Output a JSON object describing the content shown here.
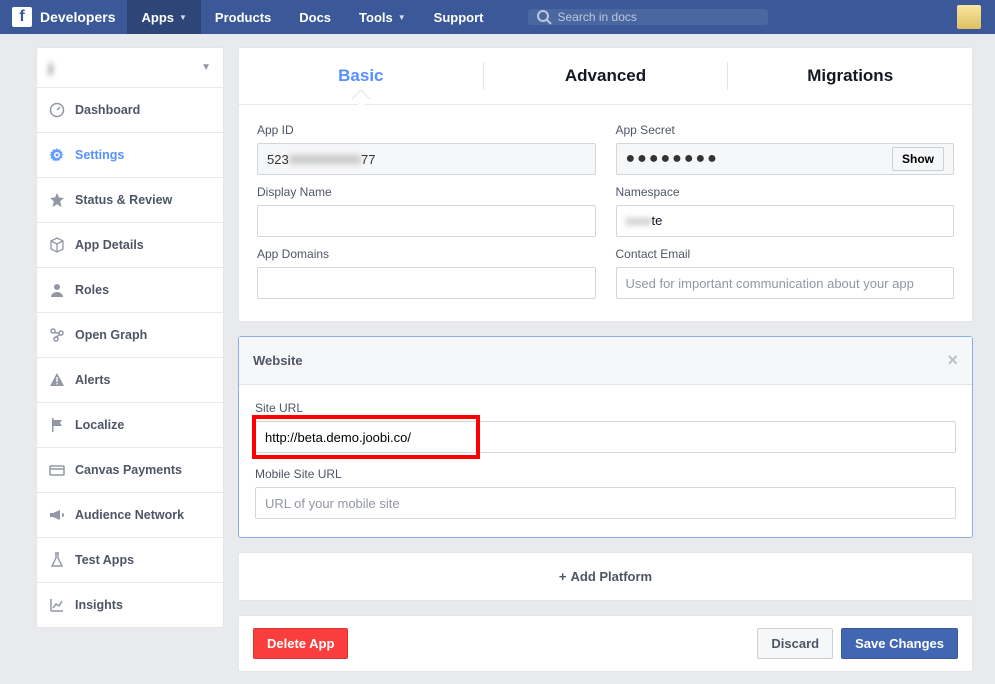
{
  "topnav": {
    "brand": "Developers",
    "items": [
      {
        "label": "Apps",
        "has_dd": true,
        "active": true
      },
      {
        "label": "Products",
        "has_dd": false
      },
      {
        "label": "Docs",
        "has_dd": false
      },
      {
        "label": "Tools",
        "has_dd": true
      },
      {
        "label": "Support",
        "has_dd": false
      }
    ],
    "search_placeholder": "Search in docs"
  },
  "sidebar": {
    "app_name": "j",
    "items": [
      {
        "label": "Dashboard"
      },
      {
        "label": "Settings"
      },
      {
        "label": "Status & Review"
      },
      {
        "label": "App Details"
      },
      {
        "label": "Roles"
      },
      {
        "label": "Open Graph"
      },
      {
        "label": "Alerts"
      },
      {
        "label": "Localize"
      },
      {
        "label": "Canvas Payments"
      },
      {
        "label": "Audience Network"
      },
      {
        "label": "Test Apps"
      },
      {
        "label": "Insights"
      }
    ]
  },
  "tabs": {
    "basic": "Basic",
    "advanced": "Advanced",
    "migrations": "Migrations"
  },
  "form": {
    "app_id_label": "App ID",
    "app_id_pre": "523",
    "app_id_post": "77",
    "app_secret_label": "App Secret",
    "app_secret_mask": "●●●●●●●●",
    "show_btn": "Show",
    "display_name_label": "Display Name",
    "display_name_value": "",
    "namespace_label": "Namespace",
    "namespace_value": "te",
    "app_domains_label": "App Domains",
    "app_domains_value": "",
    "contact_email_label": "Contact Email",
    "contact_email_placeholder": "Used for important communication about your app"
  },
  "website": {
    "title": "Website",
    "site_url_label": "Site URL",
    "site_url_value": "http://beta.demo.joobi.co/",
    "mobile_label": "Mobile Site URL",
    "mobile_placeholder": "URL of your mobile site"
  },
  "add_platform": "Add Platform",
  "footer": {
    "delete": "Delete App",
    "discard": "Discard",
    "save": "Save Changes"
  }
}
